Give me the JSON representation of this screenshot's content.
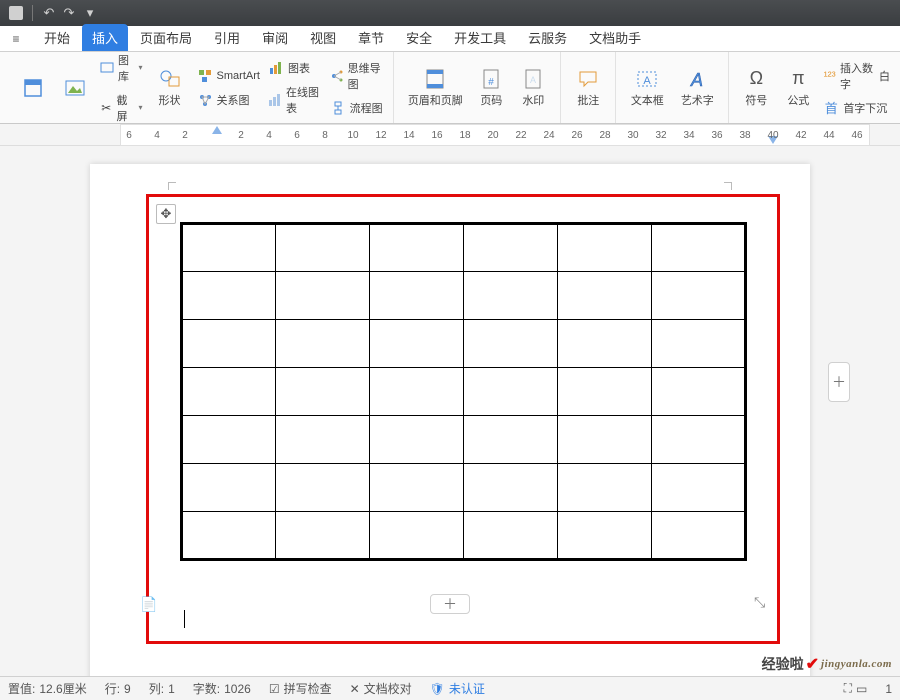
{
  "qat": {
    "save": "💾",
    "undo": "↶",
    "redo": "↷"
  },
  "tabs": {
    "menu": "≡",
    "items": [
      {
        "label": "开始",
        "active": false
      },
      {
        "label": "插入",
        "active": true
      },
      {
        "label": "页面布局",
        "active": false
      },
      {
        "label": "引用",
        "active": false
      },
      {
        "label": "审阅",
        "active": false
      },
      {
        "label": "视图",
        "active": false
      },
      {
        "label": "章节",
        "active": false
      },
      {
        "label": "安全",
        "active": false
      },
      {
        "label": "开发工具",
        "active": false
      },
      {
        "label": "云服务",
        "active": false
      },
      {
        "label": "文档助手",
        "active": false
      }
    ]
  },
  "ribbon": {
    "cover": "封",
    "pic": "图",
    "gallery": "图库",
    "screenshot": "截屏",
    "shapes": "形状",
    "smartart": "SmartArt",
    "relation": "关系图",
    "chart": "图表",
    "onlinechart": "在线图表",
    "mindmap": "思维导图",
    "flowchart": "流程图",
    "headerfooter": "页眉和页脚",
    "pagenum": "页码",
    "watermark": "水印",
    "annotate": "批注",
    "textbox": "文本框",
    "wordart": "艺术字",
    "symbol": "符号",
    "equation": "公式",
    "insertnum": "插入数字",
    "whitebox": "白",
    "dropcap": "首字下沉"
  },
  "ruler": {
    "ticks": [
      "6",
      "4",
      "2",
      "",
      "2",
      "4",
      "6",
      "8",
      "10",
      "12",
      "14",
      "16",
      "18",
      "20",
      "22",
      "24",
      "26",
      "28",
      "30",
      "32",
      "34",
      "36",
      "38",
      "40",
      "42",
      "44",
      "46"
    ],
    "leftmarker": 96,
    "rightmarker": 652
  },
  "table": {
    "rows": 7,
    "cols": 6
  },
  "handles": {
    "move": "✥",
    "plus": "＋",
    "expand": "⤡"
  },
  "status": {
    "pos_label": "置值:",
    "pos_value": "12.6厘米",
    "row_label": "行:",
    "row_value": "9",
    "col_label": "列:",
    "col_value": "1",
    "words_label": "字数:",
    "words_value": "1026",
    "spellcheck": "拼写检查",
    "proof": "文档校对",
    "notauth": "未认证",
    "zoom": "1"
  },
  "watermark": {
    "brand": "经验啦",
    "url": "jingyanla.com"
  }
}
